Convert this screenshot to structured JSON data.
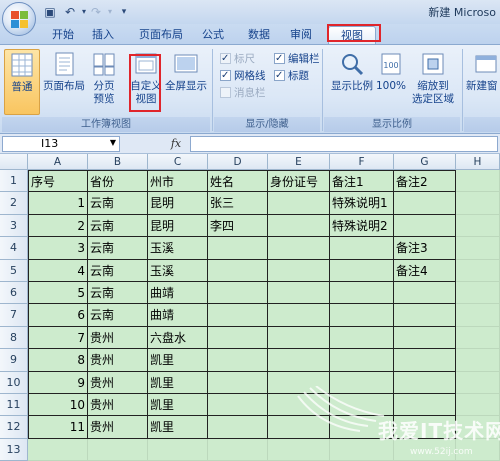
{
  "window": {
    "title": "新建 Microso"
  },
  "tabs": [
    "开始",
    "插入",
    "页面布局",
    "公式",
    "数据",
    "审阅",
    "视图"
  ],
  "active_tab": "视图",
  "ribbon": {
    "workbook_views": {
      "label": "工作簿视图",
      "buttons": [
        "普通",
        "页面布局",
        "分页\n预览",
        "自定义\n视图",
        "全屏显示"
      ]
    },
    "show_hide": {
      "label": "显示/隐藏",
      "checkboxes": [
        {
          "label": "标尺",
          "checked": true,
          "disabled": true
        },
        {
          "label": "网格线",
          "checked": true,
          "disabled": false
        },
        {
          "label": "消息栏",
          "checked": false,
          "disabled": true
        },
        {
          "label": "编辑栏",
          "checked": true,
          "disabled": false
        },
        {
          "label": "标题",
          "checked": true,
          "disabled": false
        }
      ]
    },
    "zoom": {
      "label": "显示比例",
      "buttons": [
        "显示比例",
        "100%",
        "缩放到\n选定区域"
      ]
    },
    "window": {
      "buttons": [
        "新建窗"
      ]
    }
  },
  "formula_bar": {
    "name_box": "I13",
    "fx": "fx",
    "value": ""
  },
  "columns": [
    "A",
    "B",
    "C",
    "D",
    "E",
    "F",
    "G",
    "H"
  ],
  "rows": [
    "1",
    "2",
    "3",
    "4",
    "5",
    "6",
    "7",
    "8",
    "9",
    "10",
    "11",
    "12",
    "13"
  ],
  "cells": [
    [
      "序号",
      "省份",
      "州市",
      "姓名",
      "身份证号",
      "备注1",
      "备注2",
      ""
    ],
    [
      "1",
      "云南",
      "昆明",
      "张三",
      "",
      "特殊说明1",
      "",
      ""
    ],
    [
      "2",
      "云南",
      "昆明",
      "李四",
      "",
      "特殊说明2",
      "",
      ""
    ],
    [
      "3",
      "云南",
      "玉溪",
      "",
      "",
      "",
      "备注3",
      ""
    ],
    [
      "4",
      "云南",
      "玉溪",
      "",
      "",
      "",
      "备注4",
      ""
    ],
    [
      "5",
      "云南",
      "曲靖",
      "",
      "",
      "",
      "",
      ""
    ],
    [
      "6",
      "云南",
      "曲靖",
      "",
      "",
      "",
      "",
      ""
    ],
    [
      "7",
      "贵州",
      "六盘水",
      "",
      "",
      "",
      "",
      ""
    ],
    [
      "8",
      "贵州",
      "凯里",
      "",
      "",
      "",
      "",
      ""
    ],
    [
      "9",
      "贵州",
      "凯里",
      "",
      "",
      "",
      "",
      ""
    ],
    [
      "10",
      "贵州",
      "凯里",
      "",
      "",
      "",
      "",
      ""
    ],
    [
      "11",
      "贵州",
      "凯里",
      "",
      "",
      "",
      "",
      ""
    ],
    [
      "",
      "",
      "",
      "",
      "",
      "",
      "",
      ""
    ]
  ],
  "watermark": {
    "text": "我爱IT技术网",
    "url": "www.52ij.com"
  },
  "colors": {
    "grid_fill": "#cdebcd",
    "highlight": "#e0252b"
  }
}
